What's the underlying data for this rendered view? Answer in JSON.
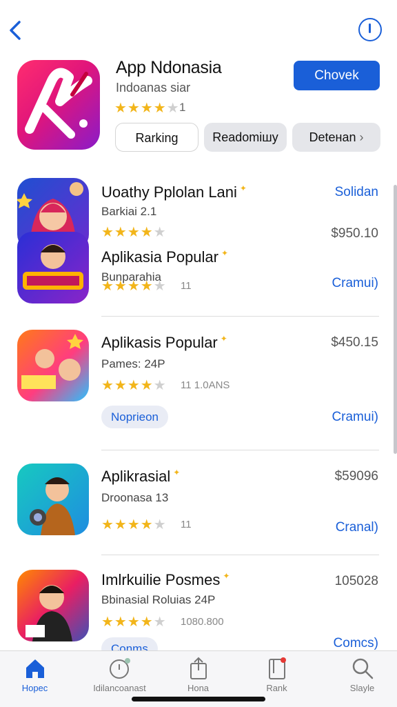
{
  "header": {
    "title": "App Ndonasia",
    "subtitle": "Indoanas siar",
    "rating_count": "1",
    "get_button": "Chovek",
    "chips": [
      "Rarking",
      "Readomiшy",
      "Deteнan"
    ]
  },
  "apps": [
    {
      "title": "Uoathy Pplolan Lani",
      "subtitle": "Barkiai 2.1",
      "price": "$950.10",
      "action": "Solidan",
      "count": "",
      "pill": ""
    },
    {
      "title": "Aplikasia Popular",
      "subtitle": "Bunparahia",
      "price": "",
      "action": "Cramui)",
      "count": "11",
      "pill": ""
    },
    {
      "title": "Aplikasis Popular",
      "subtitle": "Pames: 24P",
      "price": "$450.15",
      "action": "Cramui)",
      "count": "11  1.0ANS",
      "pill": "Noprieon"
    },
    {
      "title": "Aplikrasial",
      "subtitle": "Droonasa 13",
      "price": "$59096",
      "action": "Cranal)",
      "count": "11",
      "pill": ""
    },
    {
      "title": "Imlrkuilie Posmes",
      "subtitle": "Bbinasial Roluias 24P",
      "price": "105028",
      "action": "Comcs)",
      "count": "1080.800",
      "pill": "Conms"
    }
  ],
  "tabs": [
    {
      "label": "Hopec",
      "icon": "home-icon"
    },
    {
      "label": "Idilancoanast",
      "icon": "updates-icon"
    },
    {
      "label": "Hona",
      "icon": "share-icon"
    },
    {
      "label": "Rank",
      "icon": "rank-icon"
    },
    {
      "label": "Slayle",
      "icon": "search-icon"
    }
  ],
  "colors": {
    "accent": "#1a5fd8",
    "star": "#f2b51a",
    "hero_gradient": [
      "#ff2d6f",
      "#8a1bc9"
    ]
  }
}
